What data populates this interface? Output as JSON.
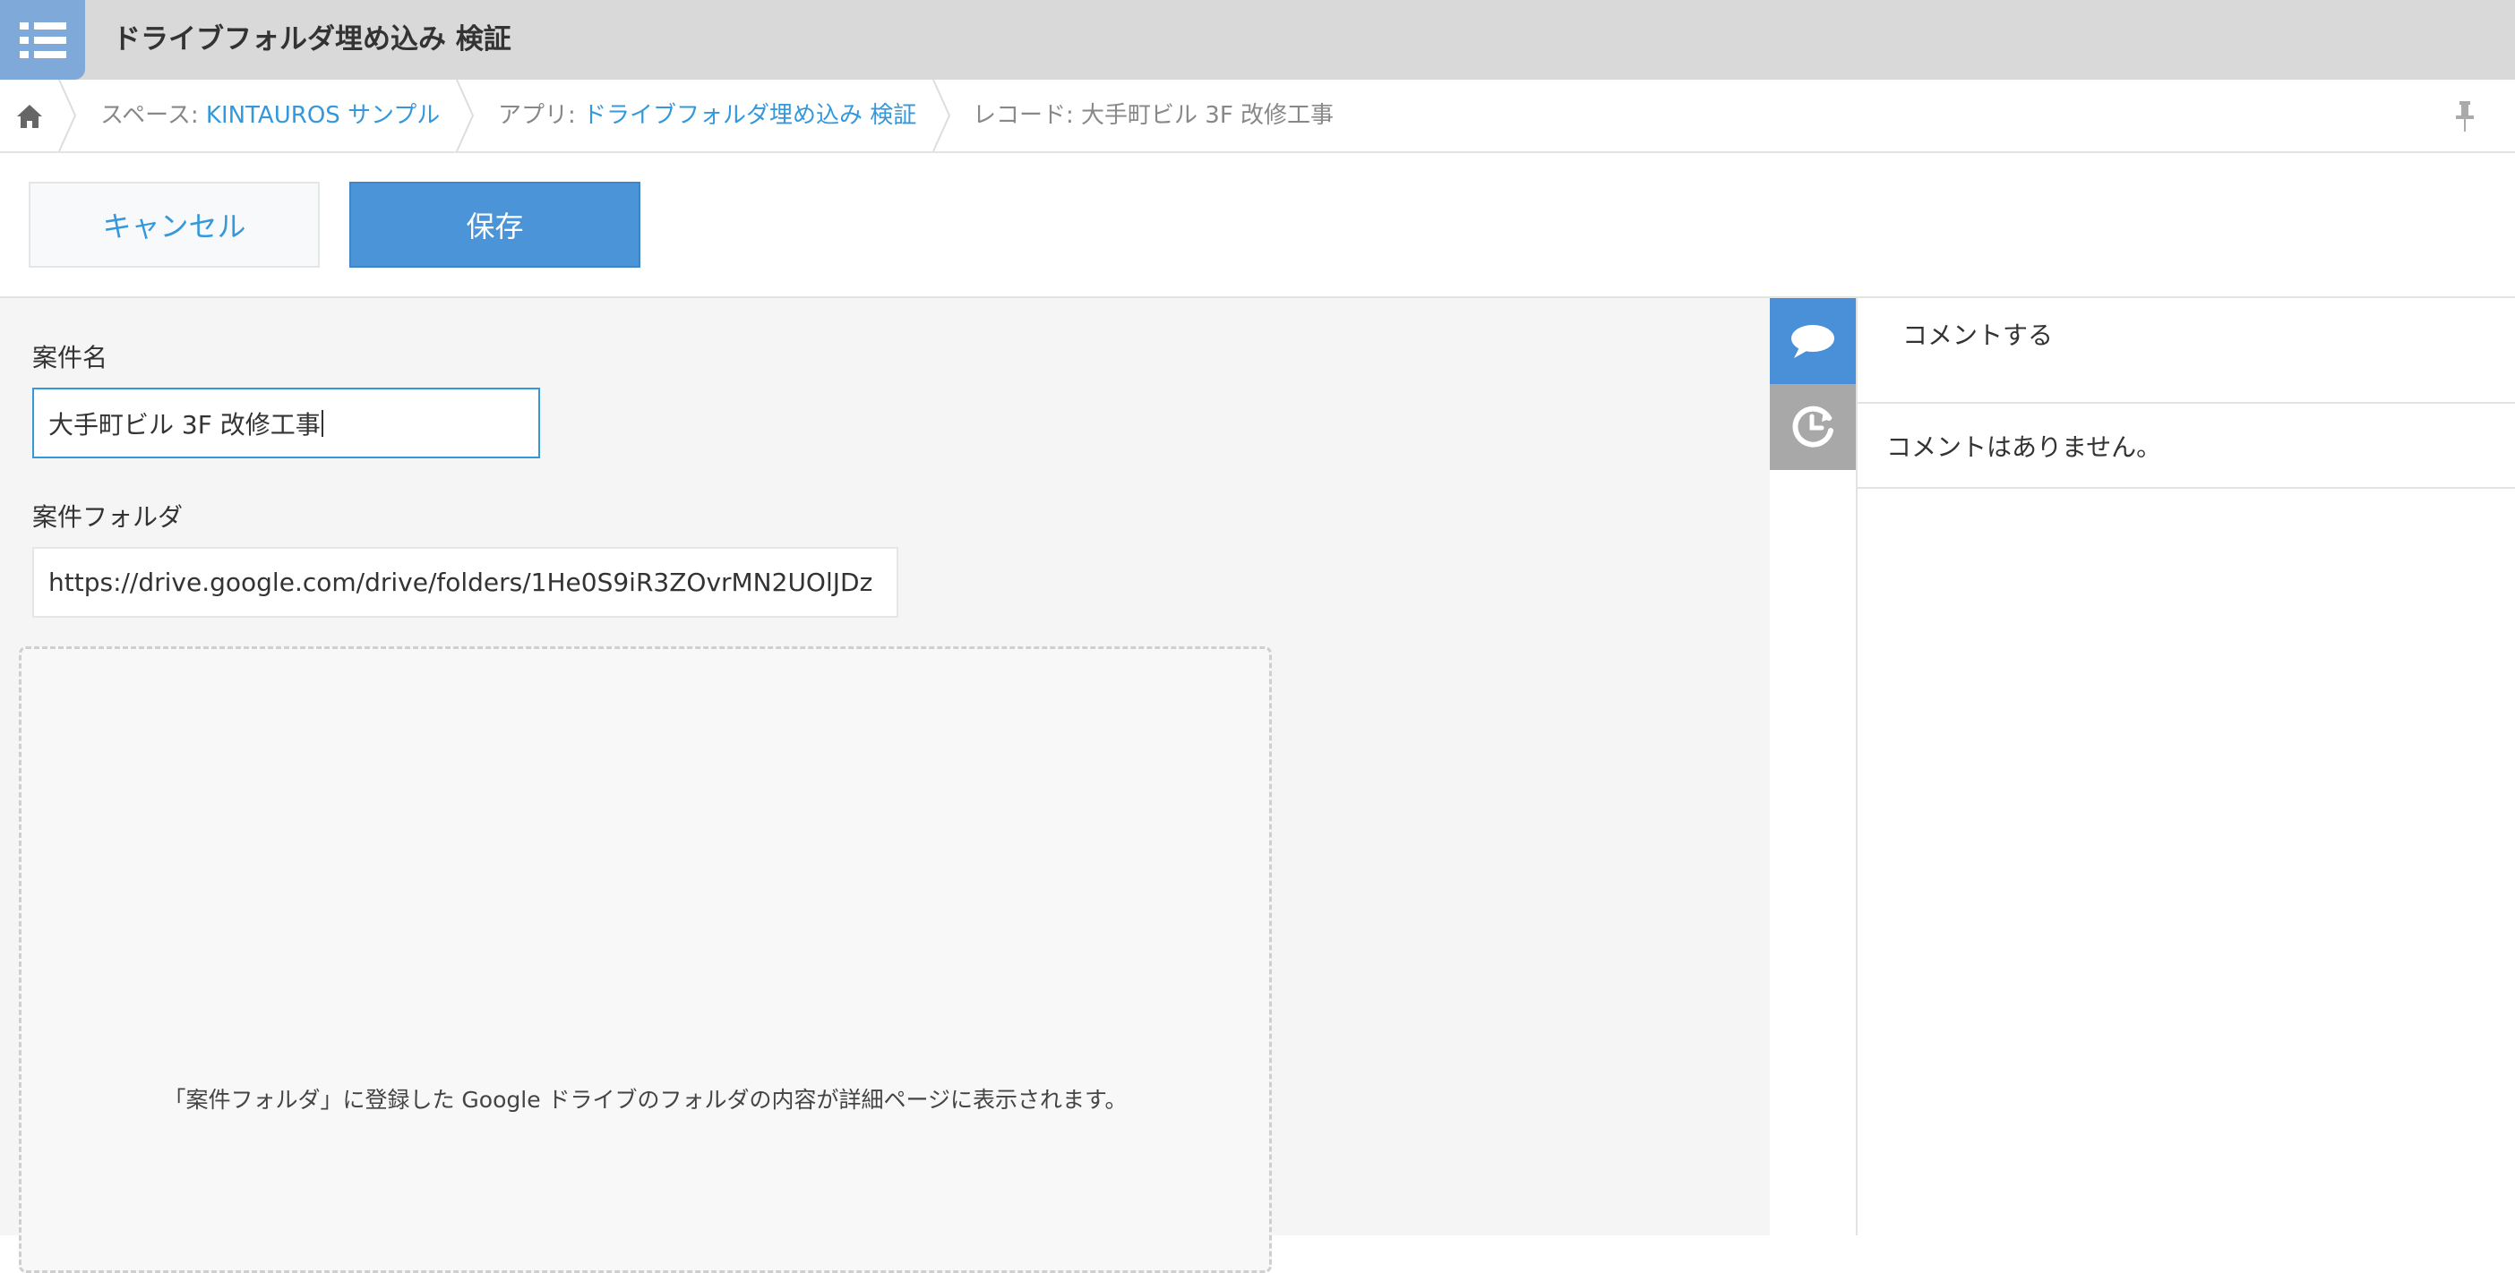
{
  "header": {
    "app_title": "ドライブフォルダ埋め込み 検証",
    "app_icon": "list-icon"
  },
  "breadcrumb": {
    "home_icon": "home-icon",
    "space_prefix": "スペース: ",
    "space_name": "KINTAUROS サンプル",
    "app_prefix": "アプリ: ",
    "app_name": "ドライブフォルダ埋め込み 検証",
    "record_prefix": "レコード: ",
    "record_name": "大手町ビル 3F 改修工事",
    "pin_icon": "pin-icon"
  },
  "toolbar": {
    "cancel_label": "キャンセル",
    "save_label": "保存"
  },
  "form": {
    "name_label": "案件名",
    "name_value": "大手町ビル 3F 改修工事",
    "folder_label": "案件フォルダ",
    "folder_value": "https://drive.google.com/drive/folders/1He0S9iR3ZOvrMN2UOlJDz",
    "drive_message": "「案件フォルダ」に登録した Google ドライブのフォルダの内容が詳細ページに表示されます。"
  },
  "side_tabs": {
    "comment_icon": "comment-icon",
    "history_icon": "history-icon"
  },
  "comments": {
    "post_placeholder": "コメントする",
    "empty_text": "コメントはありません。"
  },
  "colors": {
    "accent": "#3498db",
    "save_button": "#4c94d8",
    "header_bg": "#d9d9d9"
  }
}
